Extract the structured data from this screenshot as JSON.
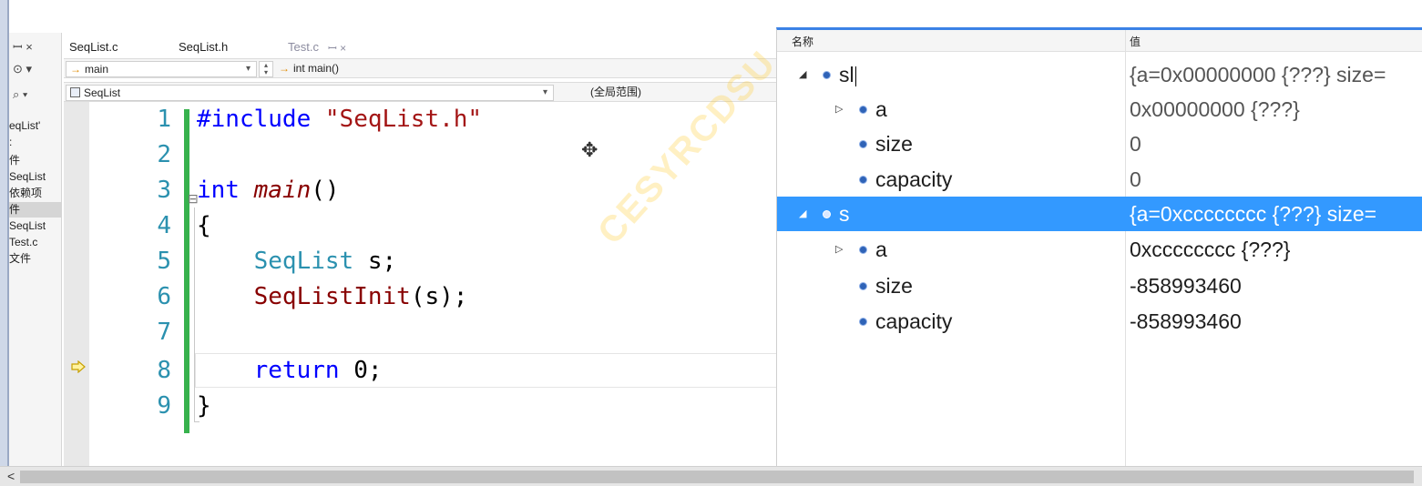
{
  "solution_explorer": {
    "pin_close": "ꟷ ×",
    "tool1": "⊙ ▾",
    "tool2": "⌕ ▾",
    "items": [
      "eqList'",
      ":",
      "件",
      "SeqList",
      "依赖项",
      "件",
      "SeqList",
      "Test.c",
      "文件"
    ],
    "selected_index": 5
  },
  "tabs": [
    {
      "label": "SeqList.c",
      "active": false
    },
    {
      "label": "SeqList.h",
      "active": false
    },
    {
      "label": "Test.c",
      "active": true
    }
  ],
  "tab_pin": "ꟷ ×",
  "nav": {
    "scope_left": "main",
    "scope_right": "int main()",
    "project": "SeqList",
    "global_scope": "(全局范围)"
  },
  "code": {
    "line_numbers": [
      "1",
      "2",
      "3",
      "4",
      "5",
      "6",
      "7",
      "8",
      "9"
    ],
    "lines": {
      "l1_directive": "#include",
      "l1_header": "\"SeqList.h\"",
      "l3_kw": "int",
      "l3_fn": "main",
      "l3_paren": "()",
      "l4": "{",
      "l5_type": "SeqList",
      "l5_rest": " s;",
      "l6_fn": "SeqListInit",
      "l6_rest": "(s);",
      "l8_kw": "return",
      "l8_rest": " 0;",
      "l9": "}"
    },
    "current_line": 8
  },
  "watch": {
    "col_name": "名称",
    "col_value": "值",
    "rows": [
      {
        "indent": 0,
        "expander": "◢",
        "name": "sl",
        "value": "{a=0x00000000 {???} size=",
        "selected": false
      },
      {
        "indent": 1,
        "expander": "▷",
        "name": "a",
        "value": "0x00000000 {???}",
        "selected": false
      },
      {
        "indent": 1,
        "expander": "",
        "name": "size",
        "value": "0",
        "selected": false
      },
      {
        "indent": 1,
        "expander": "",
        "name": "capacity",
        "value": "0",
        "selected": false
      },
      {
        "indent": 0,
        "expander": "◢",
        "name": "s",
        "value": "{a=0xcccccccc {???} size=",
        "selected": true
      },
      {
        "indent": 1,
        "expander": "▷",
        "name": "a",
        "value": "0xcccccccc {???}",
        "selected": false
      },
      {
        "indent": 1,
        "expander": "",
        "name": "size",
        "value": "-858993460",
        "selected": false
      },
      {
        "indent": 1,
        "expander": "",
        "name": "capacity",
        "value": "-858993460",
        "selected": false
      }
    ]
  },
  "watermark": "CESYRCDSU",
  "scrollbar_left": "<",
  "colors": {
    "selection": "#3399ff",
    "green_change_bar": "#37b24d",
    "line_number": "#2b91af",
    "keyword": "#0000ff",
    "string": "#a31515"
  }
}
